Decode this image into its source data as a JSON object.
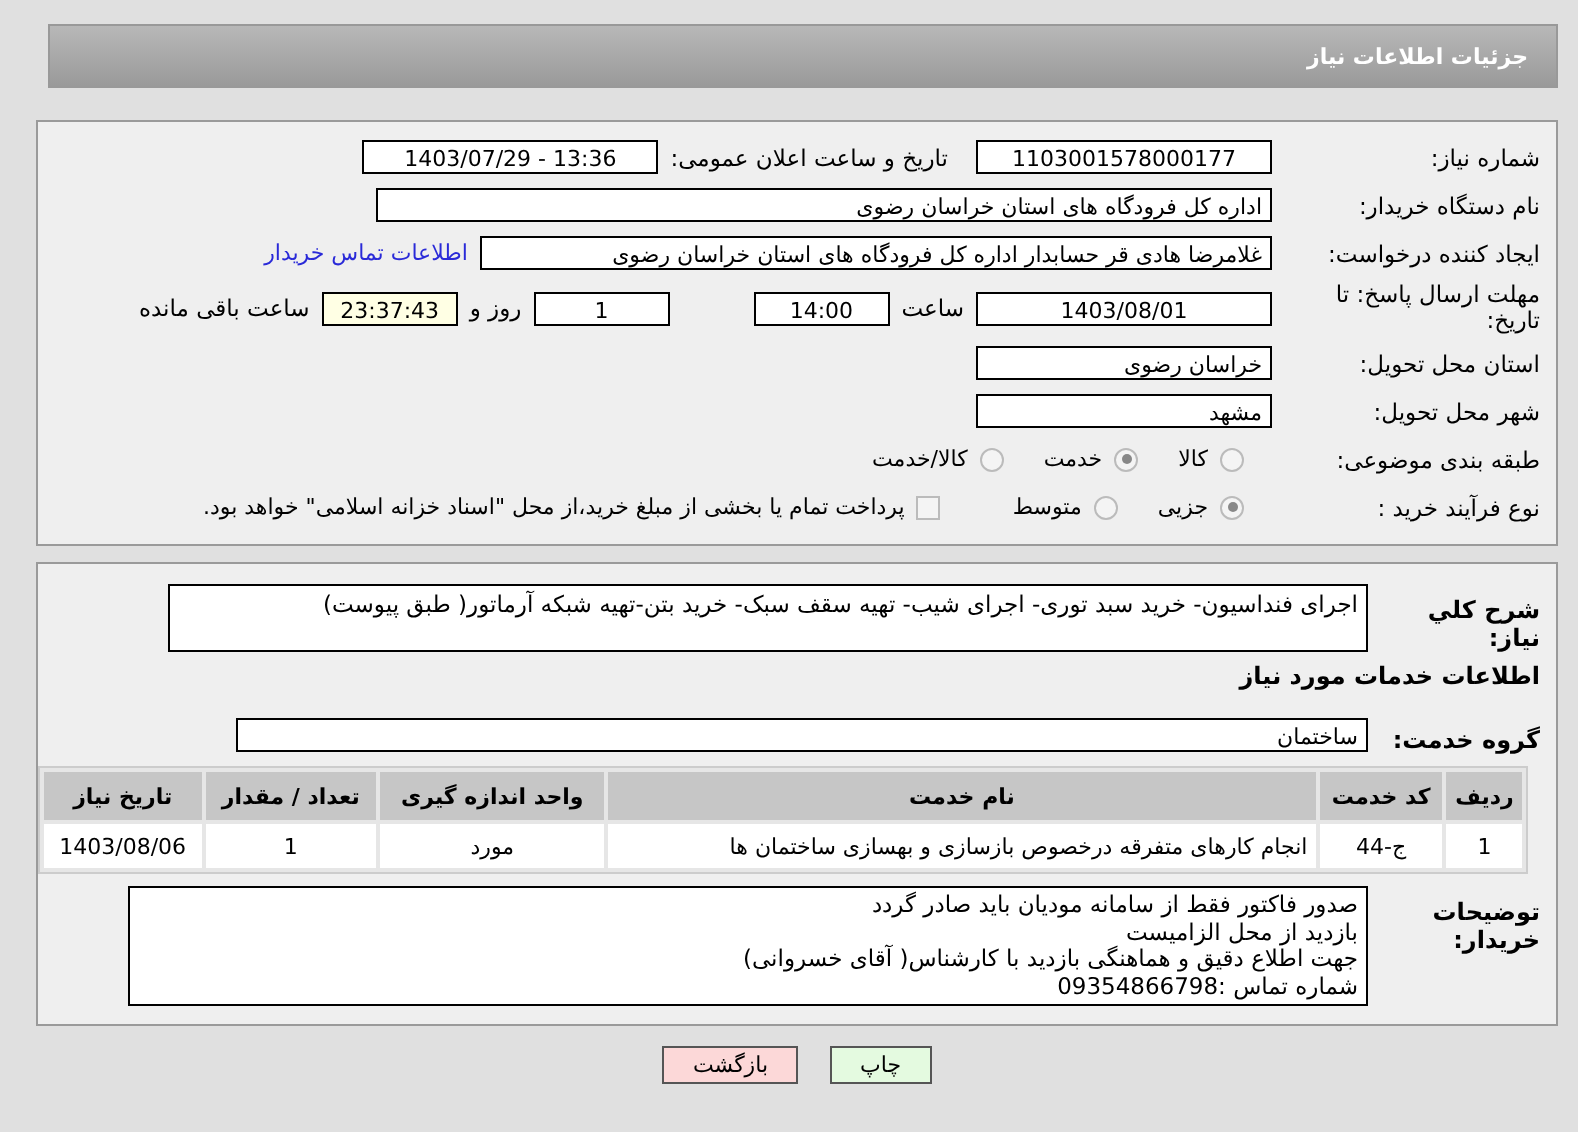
{
  "header": {
    "title": "جزئیات اطلاعات نیاز"
  },
  "need_number": {
    "label": "شماره نیاز:",
    "value": "1103001578000177"
  },
  "announce": {
    "label": "تاریخ و ساعت اعلان عمومی:",
    "value": "1403/07/29 - 13:36"
  },
  "buyer": {
    "label": "نام دستگاه خریدار:",
    "value": "اداره کل فرودگاه های استان خراسان رضوی"
  },
  "requester": {
    "label": "ایجاد کننده درخواست:",
    "value": "غلامرضا هادی قر حسابدار اداره کل فرودگاه های استان خراسان رضوی",
    "link": "اطلاعات تماس خریدار"
  },
  "deadline": {
    "label": "مهلت ارسال پاسخ: تا تاریخ:",
    "date": "1403/08/01",
    "time_label": "ساعت",
    "time": "14:00",
    "days": "1",
    "days_label": "روز و",
    "remaining": "23:37:43",
    "remaining_label": "ساعت باقی مانده"
  },
  "province": {
    "label": "استان محل تحویل:",
    "value": "خراسان رضوی"
  },
  "city": {
    "label": "شهر محل تحویل:",
    "value": "مشهد"
  },
  "category": {
    "label": "طبقه بندی موضوعی:",
    "options": [
      {
        "label": "کالا",
        "selected": false
      },
      {
        "label": "خدمت",
        "selected": true
      },
      {
        "label": "کالا/خدمت",
        "selected": false
      }
    ]
  },
  "process": {
    "label": "نوع فرآیند خرید :",
    "options": [
      {
        "label": "جزیی",
        "selected": true
      },
      {
        "label": "متوسط",
        "selected": false
      }
    ],
    "payment": {
      "label": "پرداخت تمام یا بخشی از مبلغ خرید،از محل \"اسناد خزانه اسلامی\" خواهد بود.",
      "checked": false
    }
  },
  "summary": {
    "label": "شرح كلي نياز:",
    "value": "اجرای فنداسیون- خرید سبد توری- اجرای شیب- تهیه سقف سبک- خرید بتن-تهیه شبکه آرماتور( طبق پیوست)"
  },
  "services_title": "اطلاعات خدمات مورد نیاز",
  "service_group": {
    "label": "گروه خدمت:",
    "value": "ساختمان"
  },
  "table": {
    "columns": [
      "ردیف",
      "کد خدمت",
      "نام خدمت",
      "واحد اندازه گیری",
      "تعداد / مقدار",
      "تاریخ نیاز"
    ],
    "rows": [
      [
        "1",
        "ج-44",
        "انجام کارهای متفرقه درخصوص بازسازی و بهسازی ساختمان ها",
        "مورد",
        "1",
        "1403/08/06"
      ]
    ]
  },
  "buyer_notes": {
    "label": "توضیحات خریدار:",
    "lines": [
      "صدور فاکتور فقط از سامانه مودیان باید صادر گردد",
      "بازدید از محل الزامیست",
      "جهت اطلاع دقیق و هماهنگی بازدید با کارشناس( آقای خسروانی)",
      "شماره تماس :09354866798"
    ]
  },
  "buttons": [
    {
      "label": "چاپ",
      "kind": "print"
    },
    {
      "label": "بازگشت",
      "kind": "back"
    }
  ]
}
